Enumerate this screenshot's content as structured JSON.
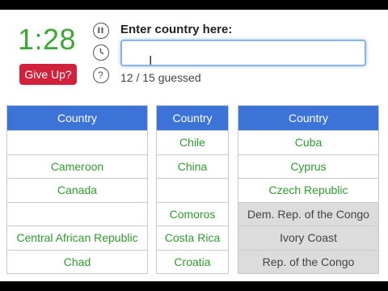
{
  "quiz": {
    "timer": "1:28",
    "give_up_label": "Give Up?",
    "prompt": "Enter country here:",
    "answer_value": "",
    "progress": "12 / 15 guessed"
  },
  "controls": {
    "icons": [
      "pause-icon",
      "clock-icon",
      "help-icon"
    ],
    "help_glyph": "?"
  },
  "colors": {
    "timer": "#39a935",
    "give_up_button": "#d2223b",
    "table_header": "#3c73d6",
    "guessed_text": "#2e9c2e",
    "missed_background": "#dcdcdc"
  },
  "tables": [
    {
      "header": "Country",
      "rows": [
        {
          "text": "",
          "missed": false
        },
        {
          "text": "Cameroon",
          "missed": false
        },
        {
          "text": "Canada",
          "missed": false
        },
        {
          "text": "",
          "missed": false
        },
        {
          "text": "Central African Republic",
          "missed": false
        },
        {
          "text": "Chad",
          "missed": false
        }
      ]
    },
    {
      "header": "Country",
      "rows": [
        {
          "text": "Chile",
          "missed": false
        },
        {
          "text": "China",
          "missed": false
        },
        {
          "text": "",
          "missed": false
        },
        {
          "text": "Comoros",
          "missed": false
        },
        {
          "text": "Costa Rica",
          "missed": false
        },
        {
          "text": "Croatia",
          "missed": false
        }
      ]
    },
    {
      "header": "Country",
      "rows": [
        {
          "text": "Cuba",
          "missed": false
        },
        {
          "text": "Cyprus",
          "missed": false
        },
        {
          "text": "Czech Republic",
          "missed": false
        },
        {
          "text": "Dem. Rep. of the Congo",
          "missed": true
        },
        {
          "text": "Ivory Coast",
          "missed": true
        },
        {
          "text": "Rep. of the Congo",
          "missed": true
        }
      ]
    }
  ]
}
